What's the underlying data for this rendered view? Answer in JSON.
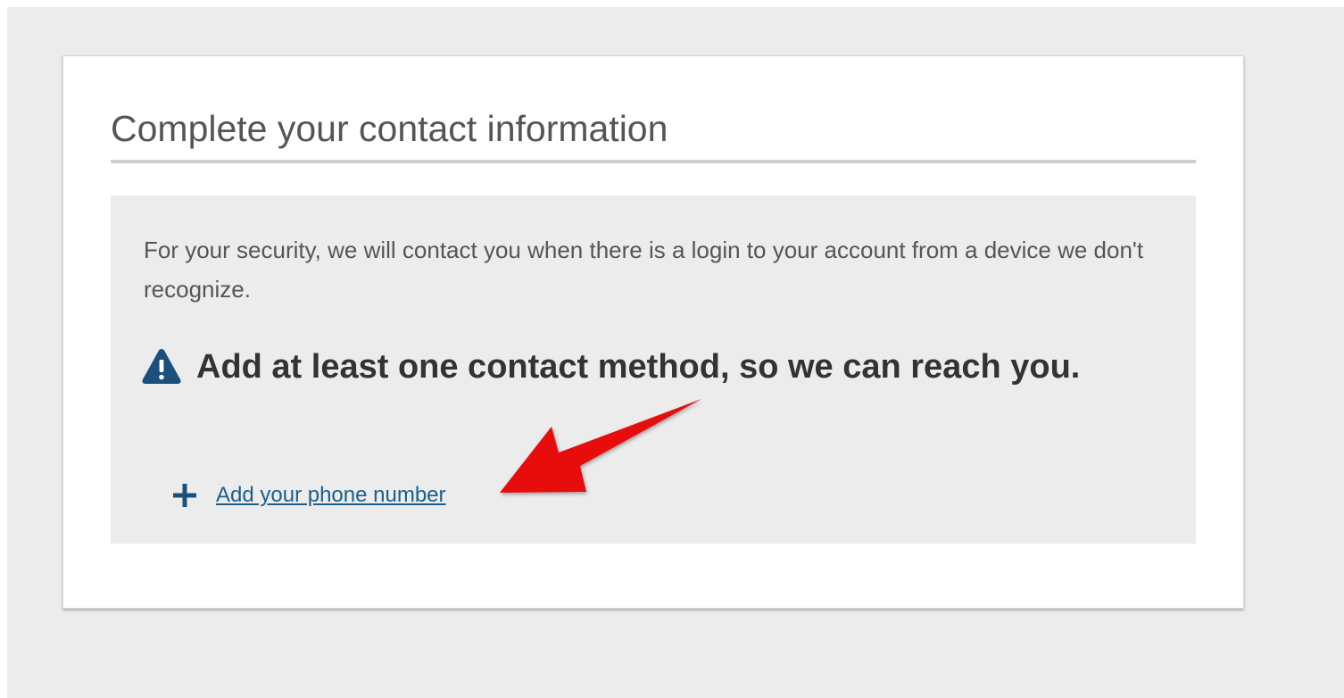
{
  "card": {
    "title": "Complete your contact information"
  },
  "notice": {
    "text": "For your security, we will contact you when there is a login to your account from a device we don't recognize.",
    "warning_icon": "warning-triangle-icon",
    "warning_heading": "Add at least one contact method, so we can reach you."
  },
  "actions": {
    "add_phone_icon": "plus-icon",
    "add_phone_label": "Add your phone number"
  },
  "annotation": {
    "icon": "red-arrow",
    "color": "#e8080a"
  },
  "colors": {
    "page_background": "#ececec",
    "card_background": "#ffffff",
    "notice_background": "#ececec",
    "link": "#1b5e8f",
    "icon_blue": "#1b4f7c",
    "heading_text": "#333333",
    "body_text": "#555555"
  }
}
